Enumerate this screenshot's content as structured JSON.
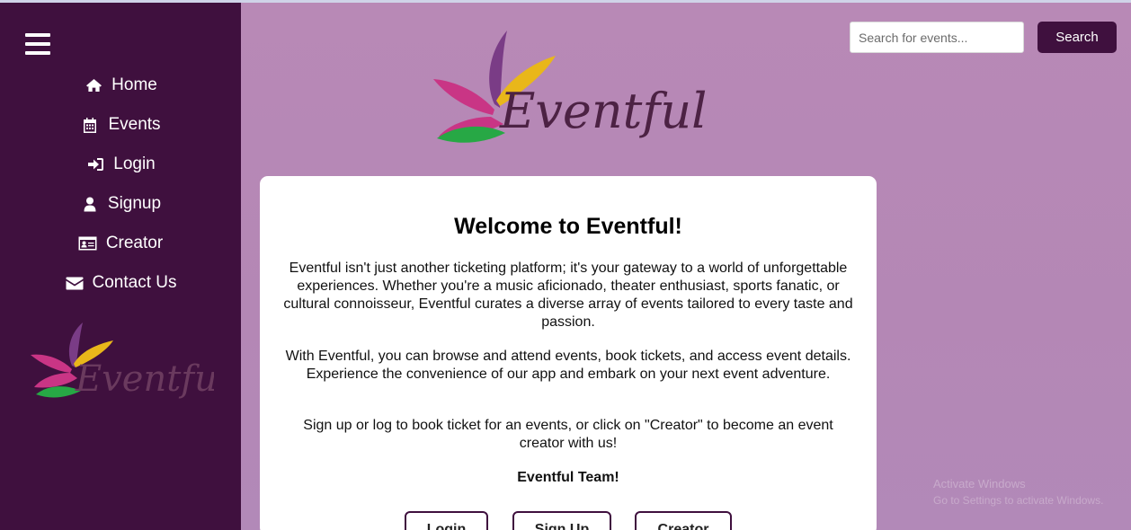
{
  "colors": {
    "sidebar": "#3f103e",
    "main_background": "#b687b6",
    "card": "#ffffff",
    "accent_button": "#3f103e"
  },
  "sidebar": {
    "menu_icon": "hamburger-icon",
    "items": [
      {
        "label": "Home",
        "icon": "home-icon"
      },
      {
        "label": "Events",
        "icon": "calendar-icon"
      },
      {
        "label": "Login",
        "icon": "sign-in-icon"
      },
      {
        "label": "Signup",
        "icon": "user-icon"
      },
      {
        "label": "Creator",
        "icon": "id-card-icon"
      },
      {
        "label": "Contact Us",
        "icon": "envelope-icon"
      }
    ],
    "logo_text": "Eventful"
  },
  "header": {
    "search_placeholder": "Search for events...",
    "search_button": "Search",
    "logo_text": "Eventful"
  },
  "card": {
    "title": "Welcome to Eventful!",
    "paragraph1": "Eventful isn't just another ticketing platform; it's your gateway to a world of unforgettable experiences. Whether you're a music aficionado, theater enthusiast, sports fanatic, or cultural connoisseur, Eventful curates a diverse array of events tailored to every taste and passion.",
    "paragraph2": "With Eventful, you can browse and attend events, book tickets, and access event details. Experience the convenience of our app and embark on your next event adventure.",
    "paragraph3": "Sign up or log to book ticket for an events, or click on \"Creator\" to become an event creator with us!",
    "signature": "Eventful Team!",
    "buttons": {
      "login": "Login",
      "signup": "Sign Up",
      "creator": "Creator"
    }
  },
  "watermark": {
    "line1": "Activate Windows",
    "line2": "Go to Settings to activate Windows."
  }
}
